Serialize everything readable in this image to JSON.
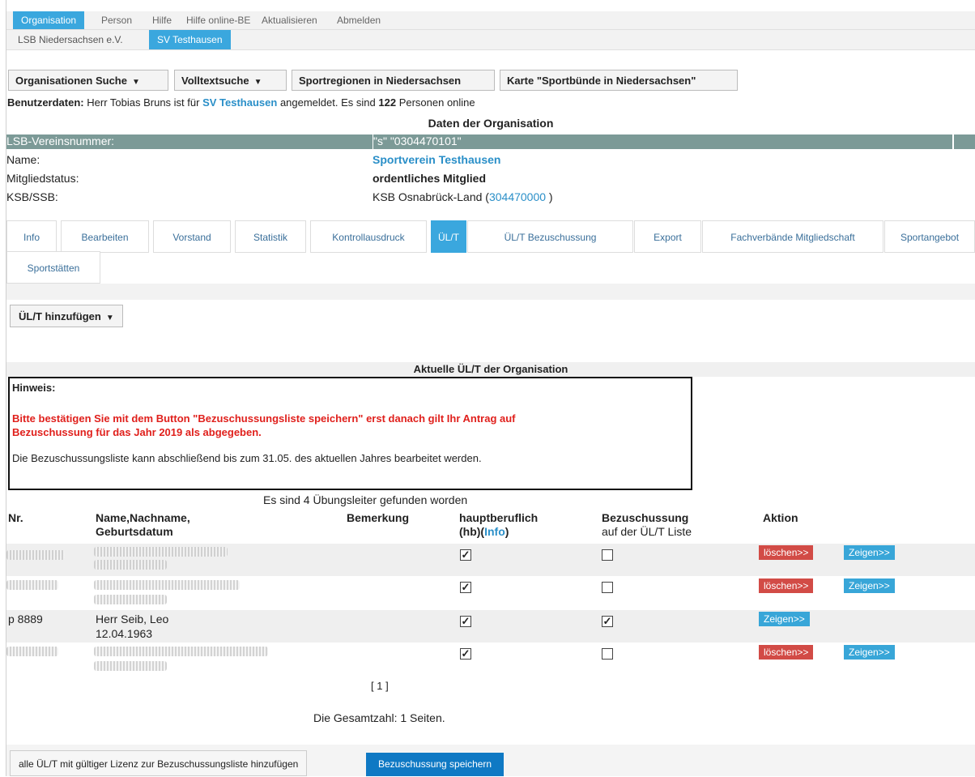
{
  "topnav": [
    "Organisation",
    "Person",
    "Hilfe",
    "Hilfe online-BE",
    "Aktualisieren",
    "Abmelden"
  ],
  "subnav": [
    "LSB Niedersachsen e.V.",
    "SV Testhausen"
  ],
  "toolbar": {
    "org_search": "Organisationen Suche",
    "fulltext": "Volltextsuche",
    "regions": "Sportregionen in Niedersachsen",
    "map": "Karte \"Sportbünde in Niedersachsen\""
  },
  "user": {
    "label": "Benutzerdaten:",
    "text1": "Herr   Tobias Bruns ist für",
    "org": "SV Testhausen",
    "text2": "angemeldet. Es sind",
    "count": "122",
    "text3": "Personen online"
  },
  "org": {
    "title": "Daten der Organisation",
    "rows": [
      {
        "label": "LSB-Vereinsnummer:",
        "value": "\"s\" \"0304470101\""
      },
      {
        "label": "Name:",
        "value": "Sportverein Testhausen"
      },
      {
        "label": "Mitgliedstatus:",
        "value": "ordentliches Mitglied"
      },
      {
        "label": "KSB/SSB:",
        "value": "KSB Osnabrück-Land (",
        "value_link": "304470000",
        "value_end": " )"
      }
    ]
  },
  "tabs": [
    "Info",
    "Bearbeiten",
    "Vorstand",
    "Statistik",
    "Kontrollausdruck",
    "ÜL/T",
    "ÜL/T Bezuschussung",
    "Export",
    "Fachverbände Mitgliedschaft",
    "Sportangebot",
    "Sportstätten"
  ],
  "add_button": "ÜL/T hinzufügen",
  "current_title": "Aktuelle ÜL/T der Organisation",
  "hinweis": {
    "head": "Hinweis:",
    "red1": "Bitte bestätigen Sie mit dem Button \"Bezuschussungsliste speichern\" erst danach gilt Ihr Antrag auf",
    "red2": "Bezuschussung für das Jahr 2019 als abgegeben.",
    "note": "Die Bezuschussungsliste kann abschließend bis zum 31.05. des aktuellen Jahres bearbeitet werden."
  },
  "found": "Es sind 4 Übungsleiter gefunden worden",
  "table": {
    "headers": {
      "nr": "Nr.",
      "name1": "Name,Nachname,",
      "name2": "Geburtsdatum",
      "remark": "Bemerkung",
      "hb1": "hauptberuflich",
      "hb2": "(hb)(",
      "hb_info": "Info",
      "hb3": ")",
      "bez1": "Bezuschussung",
      "bez2": "auf der ÜL/T Liste",
      "action": "Aktion"
    },
    "rows": [
      {
        "nr": "",
        "name1": "",
        "name2": "",
        "hb": "✓",
        "bez": "",
        "delete": "löschen>>",
        "show": "Zeigen>>"
      },
      {
        "nr": "",
        "name1": "",
        "name2": "",
        "hb": "✓",
        "bez": "",
        "delete": "löschen>>",
        "show": "Zeigen>>"
      },
      {
        "nr": "p 8889",
        "name1": "Herr Seib, Leo",
        "name2": "12.04.1963",
        "hb": "✓",
        "bez": "✓",
        "delete": "",
        "show": "Zeigen>>"
      },
      {
        "nr": "",
        "name1": "",
        "name2": "",
        "hb": "✓",
        "bez": "",
        "delete": "löschen>>",
        "show": "Zeigen>>"
      }
    ]
  },
  "pager": "[ 1 ]",
  "total": "Die Gesamtzahl: 1 Seiten.",
  "bottom": {
    "add_all": "alle ÜL/T mit gültiger Lizenz zur Bezuschussungsliste hinzufügen",
    "save": "Bezuschussung speichern"
  }
}
